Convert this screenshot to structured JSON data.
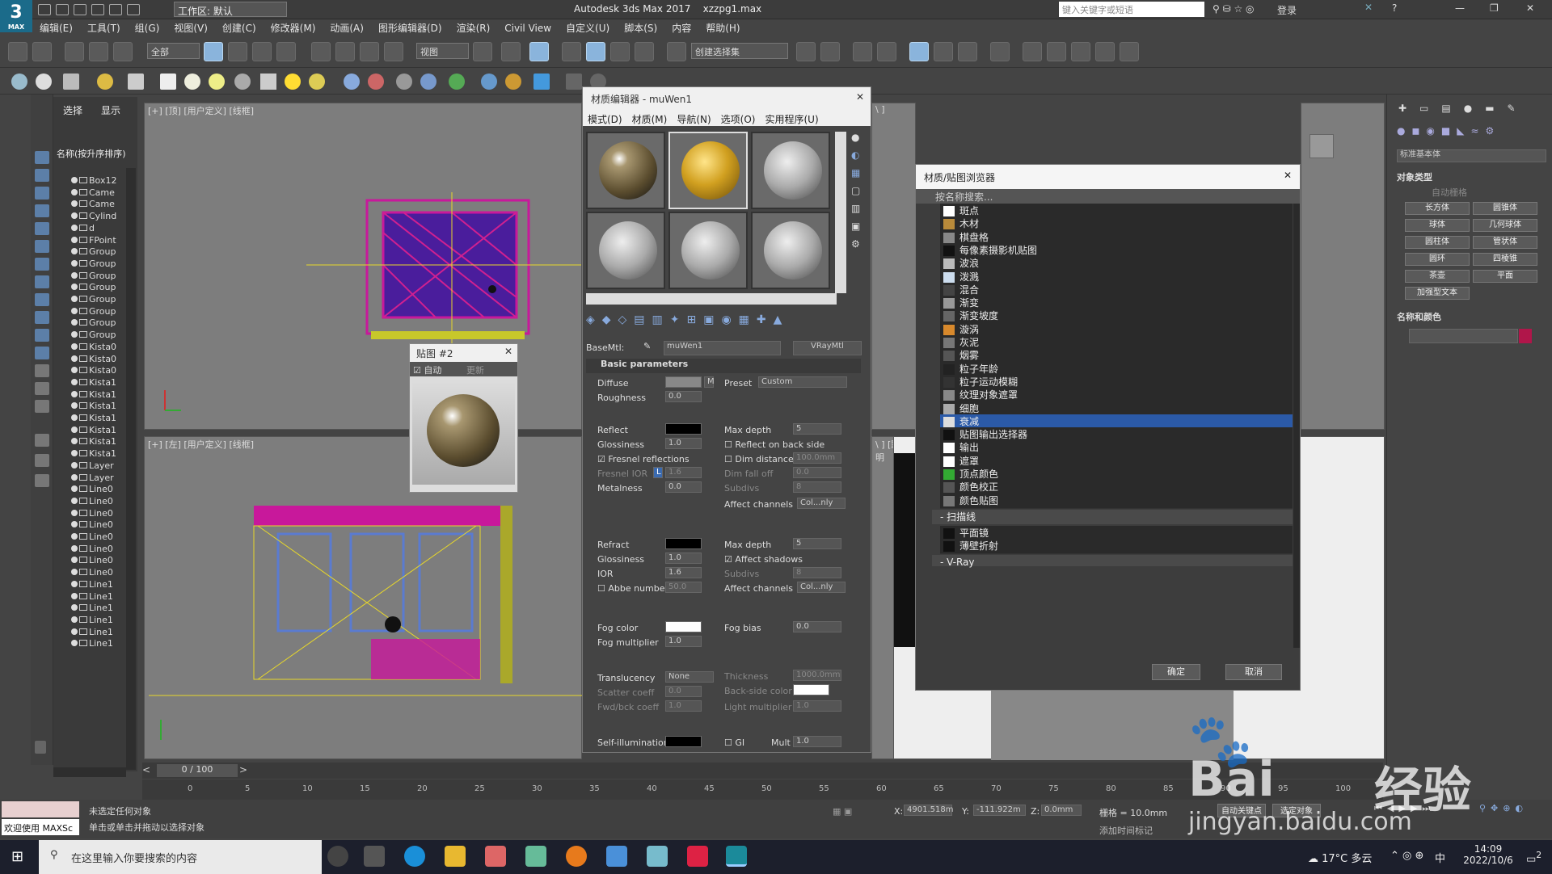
{
  "app": {
    "logo_text": "3",
    "logo_sub": "MAX",
    "workspace": "工作区: 默认",
    "title": "Autodesk 3ds Max 2017",
    "filename": "xzzpg1.max",
    "search_placeholder": "键入关键字或短语",
    "login": "登录"
  },
  "menu": [
    "编辑(E)",
    "工具(T)",
    "组(G)",
    "视图(V)",
    "创建(C)",
    "修改器(M)",
    "动画(A)",
    "图形编辑器(D)",
    "渲染(R)",
    "Civil View",
    "自定义(U)",
    "脚本(S)",
    "内容",
    "帮助(H)"
  ],
  "toolbar": {
    "filter_all": "全部",
    "view_dropdown": "视图",
    "selection_set": "创建选择集"
  },
  "scene_explorer": {
    "tabs": [
      "选择",
      "显示"
    ],
    "column": "名称(按升序排序)",
    "items": [
      "Box12",
      "Came",
      "Came",
      "Cylind",
      "d",
      "FPoint",
      "Group",
      "Group",
      "Group",
      "Group",
      "Group",
      "Group",
      "Group",
      "Group",
      "Kista0",
      "Kista0",
      "Kista0",
      "Kista1",
      "Kista1",
      "Kista1",
      "Kista1",
      "Kista1",
      "Kista1",
      "Kista1",
      "Layer",
      "Layer",
      "Line0",
      "Line0",
      "Line0",
      "Line0",
      "Line0",
      "Line0",
      "Line0",
      "Line0",
      "Line1",
      "Line1",
      "Line1",
      "Line1",
      "Line1",
      "Line1"
    ]
  },
  "viewports": {
    "top": "[+] [顶] [用户定义] [线框]",
    "left": "[+] [左] [用户定义] [线框]",
    "right_top": "\\ ]",
    "persp": "\\ ] [默认明"
  },
  "material_editor": {
    "title": "材质编辑器 - muWen1",
    "menu": [
      "模式(D)",
      "材质(M)",
      "导航(N)",
      "选项(O)",
      "实用程序(U)"
    ],
    "basemtl_label": "BaseMtl:",
    "material_name": "muWen1",
    "material_type": "VRayMtl",
    "rollout": "Basic parameters",
    "diffuse": "Diffuse",
    "diffuse_map": "M",
    "preset_label": "Preset",
    "preset_value": "Custom",
    "roughness": "Roughness",
    "roughness_val": "0.0",
    "reflect": "Reflect",
    "max_depth": "Max depth",
    "max_depth_val": "5",
    "glossiness": "Glossiness",
    "glossiness_val": "1.0",
    "reflect_back": "Reflect on back side",
    "fresnel": "Fresnel reflections",
    "dim_distance": "Dim distance",
    "dim_distance_val": "100.0mm",
    "fresnel_ior": "Fresnel IOR",
    "fresnel_l": "L",
    "fresnel_ior_val": "1.6",
    "dim_falloff": "Dim fall off",
    "dim_falloff_val": "0.0",
    "subdivs": "Subdivs",
    "subdivs_val": "8",
    "metalness": "Metalness",
    "metalness_val": "0.0",
    "affect_channels": "Affect channels",
    "affect_val": "Col...nly",
    "refract": "Refract",
    "refr_max_depth_val": "5",
    "refr_gloss_val": "1.0",
    "affect_shadows": "Affect shadows",
    "ior": "IOR",
    "ior_val": "1.6",
    "refr_subdivs_val": "8",
    "abbe": "Abbe number",
    "abbe_val": "50.0",
    "fog_color": "Fog color",
    "fog_bias": "Fog bias",
    "fog_bias_val": "0.0",
    "fog_mult": "Fog multiplier",
    "fog_mult_val": "1.0",
    "translucency": "Translucency",
    "transl_val": "None",
    "thickness": "Thickness",
    "thickness_val": "1000.0mm",
    "scatter": "Scatter coeff",
    "scatter_val": "0.0",
    "backside": "Back-side color",
    "fwdbck": "Fwd/bck coeff",
    "fwdbck_val": "1.0",
    "light_mult": "Light multiplier",
    "light_mult_val": "1.0",
    "self_illum": "Self-illumination",
    "gi": "GI",
    "mult": "Mult",
    "mult_val": "1.0"
  },
  "map_window": {
    "title": "贴图 #2",
    "auto": "自动",
    "update": "更新"
  },
  "browser": {
    "title": "材质/贴图浏览器",
    "search": "按名称搜索...",
    "items": [
      "斑点",
      "木材",
      "棋盘格",
      "每像素摄影机贴图",
      "波浪",
      "泼溅",
      "混合",
      "渐变",
      "渐变坡度",
      "漩涡",
      "灰泥",
      "烟雾",
      "粒子年龄",
      "粒子运动模糊",
      "纹理对象遮罩",
      "细胞",
      "衰减",
      "贴图输出选择器",
      "输出",
      "遮罩",
      "顶点颜色",
      "颜色校正",
      "颜色贴图"
    ],
    "selected": "衰减",
    "group_scanline": "- 扫描线",
    "scanline_items": [
      "平面镜",
      "薄壁折射"
    ],
    "group_vray": "- V-Ray",
    "ok": "确定",
    "cancel": "取消"
  },
  "command_panel": {
    "dropdown": "标准基本体",
    "object_type": "对象类型",
    "autogrid": "自动栅格",
    "buttons": [
      "长方体",
      "圆锥体",
      "球体",
      "几何球体",
      "圆柱体",
      "管状体",
      "圆环",
      "四棱锥",
      "茶壶",
      "平面",
      "加强型文本"
    ],
    "name_color": "名称和颜色"
  },
  "timeline": {
    "frame": "0 / 100",
    "ticks": [
      "0",
      "5",
      "10",
      "15",
      "20",
      "25",
      "30",
      "35",
      "40",
      "45",
      "50",
      "55",
      "60",
      "65",
      "70",
      "75",
      "80",
      "85",
      "90",
      "95",
      "100"
    ]
  },
  "status": {
    "welcome": "欢迎使用 MAXSc",
    "line1": "未选定任何对象",
    "line2": "单击或单击并拖动以选择对象",
    "x_label": "X:",
    "x_val": "4901.518m",
    "y_label": "Y:",
    "y_val": "-111.922m",
    "z_label": "Z:",
    "z_val": "0.0mm",
    "grid": "栅格 = 10.0mm",
    "add_tag": "添加时间标记",
    "auto_key": "自动关键点",
    "set_key": "选定对象"
  },
  "watermark": {
    "brand": "Bai",
    "brand2": "经验",
    "url": "jingyan.baidu.com"
  },
  "taskbar": {
    "search": "在这里输入你要搜索的内容",
    "weather": "17°C 多云",
    "ime": "中",
    "time": "14:09",
    "date": "2022/10/6",
    "notif": "2"
  },
  "colors": {
    "accent": "#2b5aa8",
    "viewport_bg": "#7d7d7d",
    "magenta": "#c8189b",
    "yellow": "#e8d82a"
  }
}
